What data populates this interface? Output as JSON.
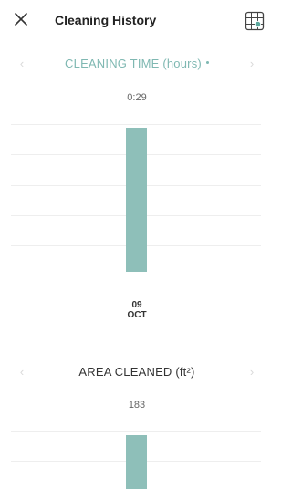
{
  "header": {
    "title": "Cleaning History",
    "close_icon": "close-icon",
    "map_icon": "map-grid-icon"
  },
  "colors": {
    "accent": "#7fb8b2",
    "bar": "#8ebfb9",
    "arrow_disabled": "#d9d9d9",
    "gridline": "#eeeeee"
  },
  "sections": [
    {
      "title": "CLEANING TIME (hours)",
      "has_dot": true,
      "active": true,
      "value_label": "0:29",
      "prev_icon": "chevron-left-icon",
      "next_icon": "chevron-right-icon"
    },
    {
      "title": "AREA CLEANED (ft²)",
      "has_dot": false,
      "active": false,
      "value_label": "183",
      "prev_icon": "chevron-left-icon",
      "next_icon": "chevron-right-icon"
    }
  ],
  "date": {
    "day": "09",
    "month": "OCT"
  }
}
